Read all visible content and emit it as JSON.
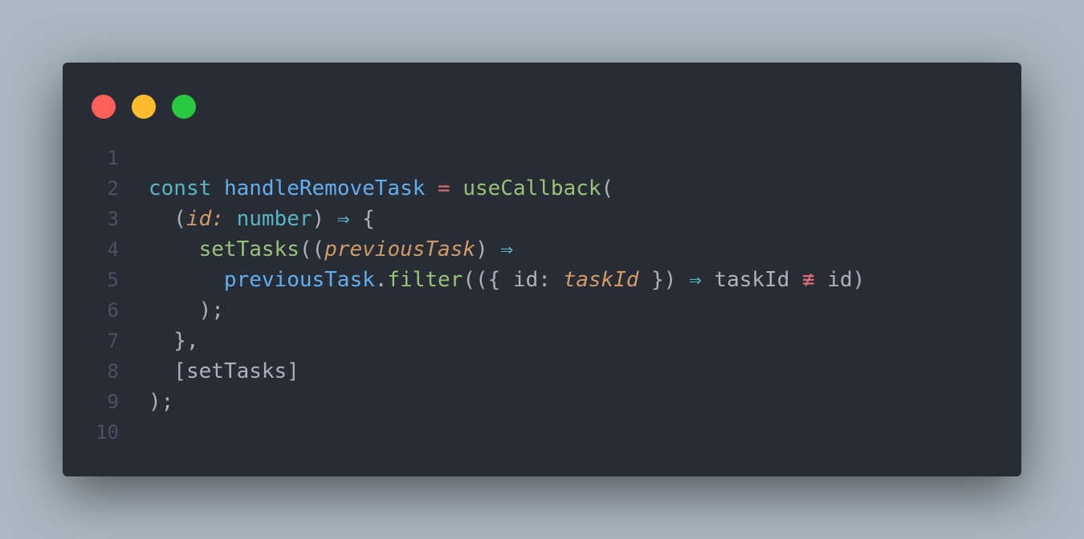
{
  "window": {
    "controls": {
      "close_color": "#ff5f56",
      "minimize_color": "#ffbd2e",
      "maximize_color": "#27c93f"
    }
  },
  "colors": {
    "background": "#abb8c3",
    "editor_background": "#282c34"
  },
  "editor": {
    "lines": [
      {
        "number": "1",
        "tokens": []
      },
      {
        "number": "2",
        "tokens": [
          {
            "text": "const",
            "type": "kw"
          },
          {
            "text": " ",
            "type": "text"
          },
          {
            "text": "handleRemoveTask",
            "type": "fn"
          },
          {
            "text": " ",
            "type": "text"
          },
          {
            "text": "=",
            "type": "op"
          },
          {
            "text": " ",
            "type": "text"
          },
          {
            "text": "useCallback",
            "type": "call"
          },
          {
            "text": "(",
            "type": "text"
          }
        ]
      },
      {
        "number": "3",
        "tokens": [
          {
            "text": "  (",
            "type": "text"
          },
          {
            "text": "id",
            "type": "param"
          },
          {
            "text": ":",
            "type": "param"
          },
          {
            "text": " ",
            "type": "text"
          },
          {
            "text": "number",
            "type": "type"
          },
          {
            "text": ") ",
            "type": "text"
          },
          {
            "text": "⇒",
            "type": "arrow"
          },
          {
            "text": " {",
            "type": "text"
          }
        ]
      },
      {
        "number": "4",
        "tokens": [
          {
            "text": "    ",
            "type": "text"
          },
          {
            "text": "setTasks",
            "type": "call"
          },
          {
            "text": "((",
            "type": "text"
          },
          {
            "text": "previousTask",
            "type": "param"
          },
          {
            "text": ") ",
            "type": "text"
          },
          {
            "text": "⇒",
            "type": "arrow"
          }
        ]
      },
      {
        "number": "5",
        "tokens": [
          {
            "text": "      ",
            "type": "text"
          },
          {
            "text": "previousTask",
            "type": "fn"
          },
          {
            "text": ".",
            "type": "text"
          },
          {
            "text": "filter",
            "type": "call"
          },
          {
            "text": "(({ id: ",
            "type": "text"
          },
          {
            "text": "taskId",
            "type": "param"
          },
          {
            "text": " }) ",
            "type": "text"
          },
          {
            "text": "⇒",
            "type": "arrow"
          },
          {
            "text": " taskId ",
            "type": "text"
          },
          {
            "text": "≢",
            "type": "neq"
          },
          {
            "text": " id)",
            "type": "text"
          }
        ]
      },
      {
        "number": "6",
        "tokens": [
          {
            "text": "    );",
            "type": "text"
          }
        ]
      },
      {
        "number": "7",
        "tokens": [
          {
            "text": "  },",
            "type": "text"
          }
        ]
      },
      {
        "number": "8",
        "tokens": [
          {
            "text": "  [setTasks]",
            "type": "text"
          }
        ]
      },
      {
        "number": "9",
        "tokens": [
          {
            "text": ");",
            "type": "text"
          }
        ]
      },
      {
        "number": "10",
        "tokens": []
      }
    ]
  }
}
